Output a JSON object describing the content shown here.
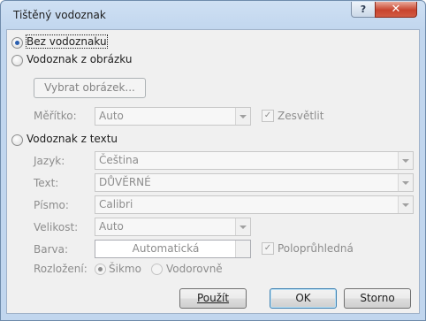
{
  "window": {
    "title": "Tištěný vodoznak",
    "help_glyph": "?",
    "close_glyph": "✕"
  },
  "options": {
    "no_watermark": "Bez vodoznaku",
    "picture_watermark": "Vodoznak z obrázku",
    "text_watermark": "Vodoznak z textu",
    "selected": "no_watermark"
  },
  "picture": {
    "select_button": "Vybrat obrázek...",
    "scale_label": "Měřítko:",
    "scale_value": "Auto",
    "washout_label": "Zesvětlit",
    "washout_checked": true
  },
  "text": {
    "language_label": "Jazyk:",
    "language_value": "Čeština",
    "text_label": "Text:",
    "text_value": "DŮVĚRNÉ",
    "font_label": "Písmo:",
    "font_value": "Calibri",
    "size_label": "Velikost:",
    "size_value": "Auto",
    "color_label": "Barva:",
    "color_value": "Automatická",
    "semitransparent_label": "Poloprůhledná",
    "semitransparent_checked": true,
    "layout_label": "Rozložení:",
    "layout_diagonal": "Šikmo",
    "layout_horizontal": "Vodorovně",
    "layout_selected": "diagonal"
  },
  "buttons": {
    "apply": "Použít",
    "ok": "OK",
    "cancel": "Storno"
  }
}
